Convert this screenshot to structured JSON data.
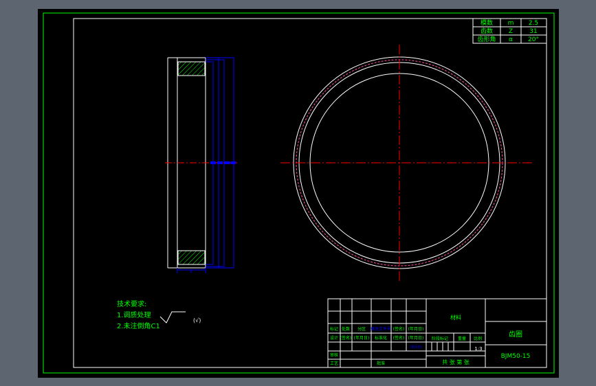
{
  "params": {
    "rows": [
      {
        "name": "模数",
        "sym": "m",
        "val": "2.5"
      },
      {
        "name": "齿数",
        "sym": "Z",
        "val": "31"
      },
      {
        "name": "齿形角",
        "sym": "α",
        "val": "20°"
      }
    ]
  },
  "side_view": {
    "width_dim": "B"
  },
  "tech": {
    "title": "技术要求:",
    "item1": "1.调质处理",
    "item2": "2.未注倒角C1",
    "roughness": "(√)"
  },
  "title_block": {
    "material": "材料",
    "part_name": "齿圈",
    "drawing_no": "BJM50-15",
    "scale": "1:3",
    "row_labels_1": [
      "标记",
      "处数",
      "分区",
      "更改文件号",
      "(签名)",
      "(年月日)"
    ],
    "row_labels_2": [
      "设计",
      "(签名)",
      "(年月日)",
      "标准化",
      "(签名)",
      "(年月日)"
    ],
    "stage_headers": [
      "阶段标记",
      "重量",
      "比例"
    ],
    "review": "审核",
    "process": "工艺",
    "approve": "批准",
    "sheets": "共 张 第 张",
    "blue_label": "更改文件号",
    "blue_small": "(年月日)"
  },
  "colors": {
    "sheet_border": "#00ff00",
    "line": "#ffffff",
    "center": "#ff0000",
    "dimension": "#0000ff",
    "hatch": "#00ff00",
    "text": "#00ff00",
    "highlight": "#ff00ff"
  }
}
